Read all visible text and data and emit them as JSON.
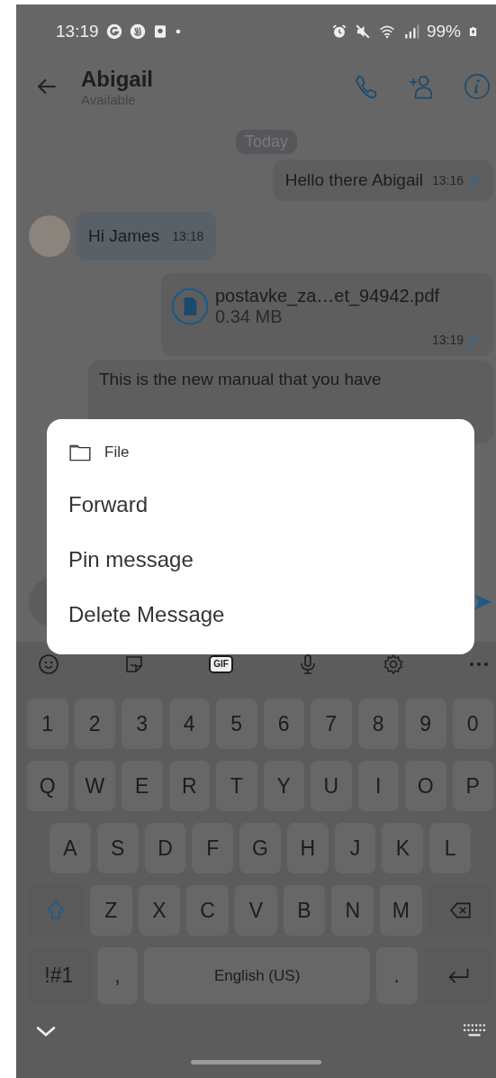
{
  "status_bar": {
    "time": "13:19",
    "battery": "99%"
  },
  "header": {
    "name": "Abigail",
    "status": "Available"
  },
  "messages": [
    {
      "kind": "date",
      "text": "Today"
    },
    {
      "kind": "outgoing",
      "text": "Hello there Abigail",
      "time": "13:16",
      "read": true
    },
    {
      "kind": "incoming",
      "text": "Hi James",
      "time": "13:18"
    },
    {
      "kind": "file",
      "file_name": "postavke_za…et_94942.pdf",
      "size": "0.34 MB",
      "time": "13:19",
      "read": true
    },
    {
      "kind": "outgoing_cut",
      "text": "This is the new manual that you have"
    }
  ],
  "context_menu": [
    {
      "kind": "header",
      "label": "File"
    },
    {
      "kind": "action",
      "label": "Forward"
    },
    {
      "kind": "action",
      "label": "Pin message"
    },
    {
      "kind": "action",
      "label": "Delete Message"
    }
  ],
  "keyboard": {
    "gif_label": "GIF",
    "number_row": [
      {
        "kind": "char",
        "label": "1"
      },
      {
        "kind": "char",
        "label": "2"
      },
      {
        "kind": "char",
        "label": "3"
      },
      {
        "kind": "char",
        "label": "4"
      },
      {
        "kind": "char",
        "label": "5"
      },
      {
        "kind": "char",
        "label": "6"
      },
      {
        "kind": "char",
        "label": "7"
      },
      {
        "kind": "char",
        "label": "8"
      },
      {
        "kind": "char",
        "label": "9"
      },
      {
        "kind": "char",
        "label": "0"
      }
    ],
    "top_row": [
      {
        "kind": "char",
        "label": "Q"
      },
      {
        "kind": "char",
        "label": "W"
      },
      {
        "kind": "char",
        "label": "E"
      },
      {
        "kind": "char",
        "label": "R"
      },
      {
        "kind": "char",
        "label": "T"
      },
      {
        "kind": "char",
        "label": "Y"
      },
      {
        "kind": "char",
        "label": "U"
      },
      {
        "kind": "char",
        "label": "I"
      },
      {
        "kind": "char",
        "label": "O"
      },
      {
        "kind": "char",
        "label": "P"
      }
    ],
    "home_row": [
      {
        "kind": "char",
        "label": "A"
      },
      {
        "kind": "char",
        "label": "S"
      },
      {
        "kind": "char",
        "label": "D"
      },
      {
        "kind": "char",
        "label": "F"
      },
      {
        "kind": "char",
        "label": "G"
      },
      {
        "kind": "char",
        "label": "H"
      },
      {
        "kind": "char",
        "label": "J"
      },
      {
        "kind": "char",
        "label": "K"
      },
      {
        "kind": "char",
        "label": "L"
      }
    ],
    "bottom_letter_row": [
      {
        "kind": "shift"
      },
      {
        "kind": "char",
        "label": "Z"
      },
      {
        "kind": "char",
        "label": "X"
      },
      {
        "kind": "char",
        "label": "C"
      },
      {
        "kind": "char",
        "label": "V"
      },
      {
        "kind": "char",
        "label": "B"
      },
      {
        "kind": "char",
        "label": "N"
      },
      {
        "kind": "char",
        "label": "M"
      },
      {
        "kind": "backspace"
      }
    ],
    "function_row": [
      {
        "kind": "symbols",
        "label": "!#1"
      },
      {
        "kind": "char",
        "label": ","
      },
      {
        "kind": "space",
        "label": "English (US)"
      },
      {
        "kind": "char",
        "label": "."
      },
      {
        "kind": "enter"
      }
    ]
  }
}
